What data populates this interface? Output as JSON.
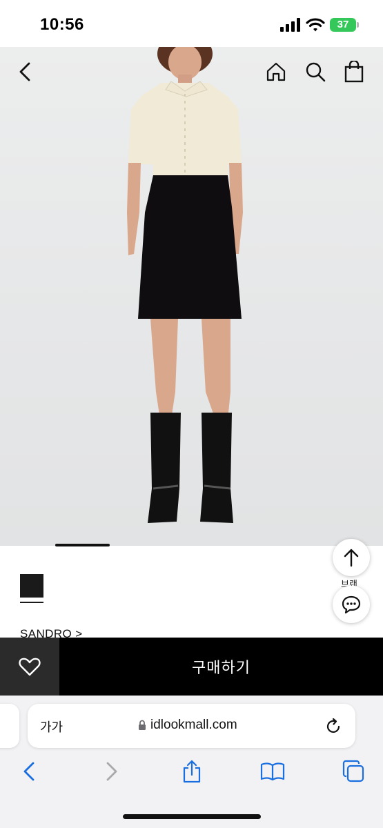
{
  "status_bar": {
    "time": "10:56",
    "battery_level": "37",
    "battery_color": "#34c759"
  },
  "header": {
    "back_icon": "chevron-left-icon",
    "home_icon": "home-icon",
    "search_icon": "search-icon",
    "bag_icon": "shopping-bag-icon"
  },
  "product": {
    "image_description_icon": "product-photo",
    "color_swatch": "#1a1a1a",
    "brand": "SANDRO >"
  },
  "floating": {
    "top_label": "브랜",
    "top_icon": "arrow-up-icon",
    "chat_icon": "chat-bubble-icon"
  },
  "purchase": {
    "wish_icon": "heart-icon",
    "buy_label": "구매하기"
  },
  "browser": {
    "text_size_label": "가가",
    "url": "idlookmall.com",
    "lock_icon": "lock-icon",
    "reload_icon": "reload-icon",
    "toolbar": [
      "back-icon",
      "forward-icon",
      "share-icon",
      "bookmarks-icon",
      "tabs-icon"
    ]
  }
}
